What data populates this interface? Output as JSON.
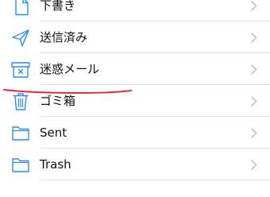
{
  "colors": {
    "accent": "#2d8cf0",
    "chevron": "#c4c4c7",
    "divider": "#e3e3e6",
    "annotation": "#e0303a"
  },
  "mailboxes": [
    {
      "label": "下書き",
      "icon": "draft-icon"
    },
    {
      "label": "送信済み",
      "icon": "sent-icon"
    },
    {
      "label": "迷惑メール",
      "icon": "junk-icon"
    },
    {
      "label": "ゴミ箱",
      "icon": "trash-icon"
    },
    {
      "label": "Sent",
      "icon": "folder-icon"
    },
    {
      "label": "Trash",
      "icon": "folder-icon"
    }
  ]
}
